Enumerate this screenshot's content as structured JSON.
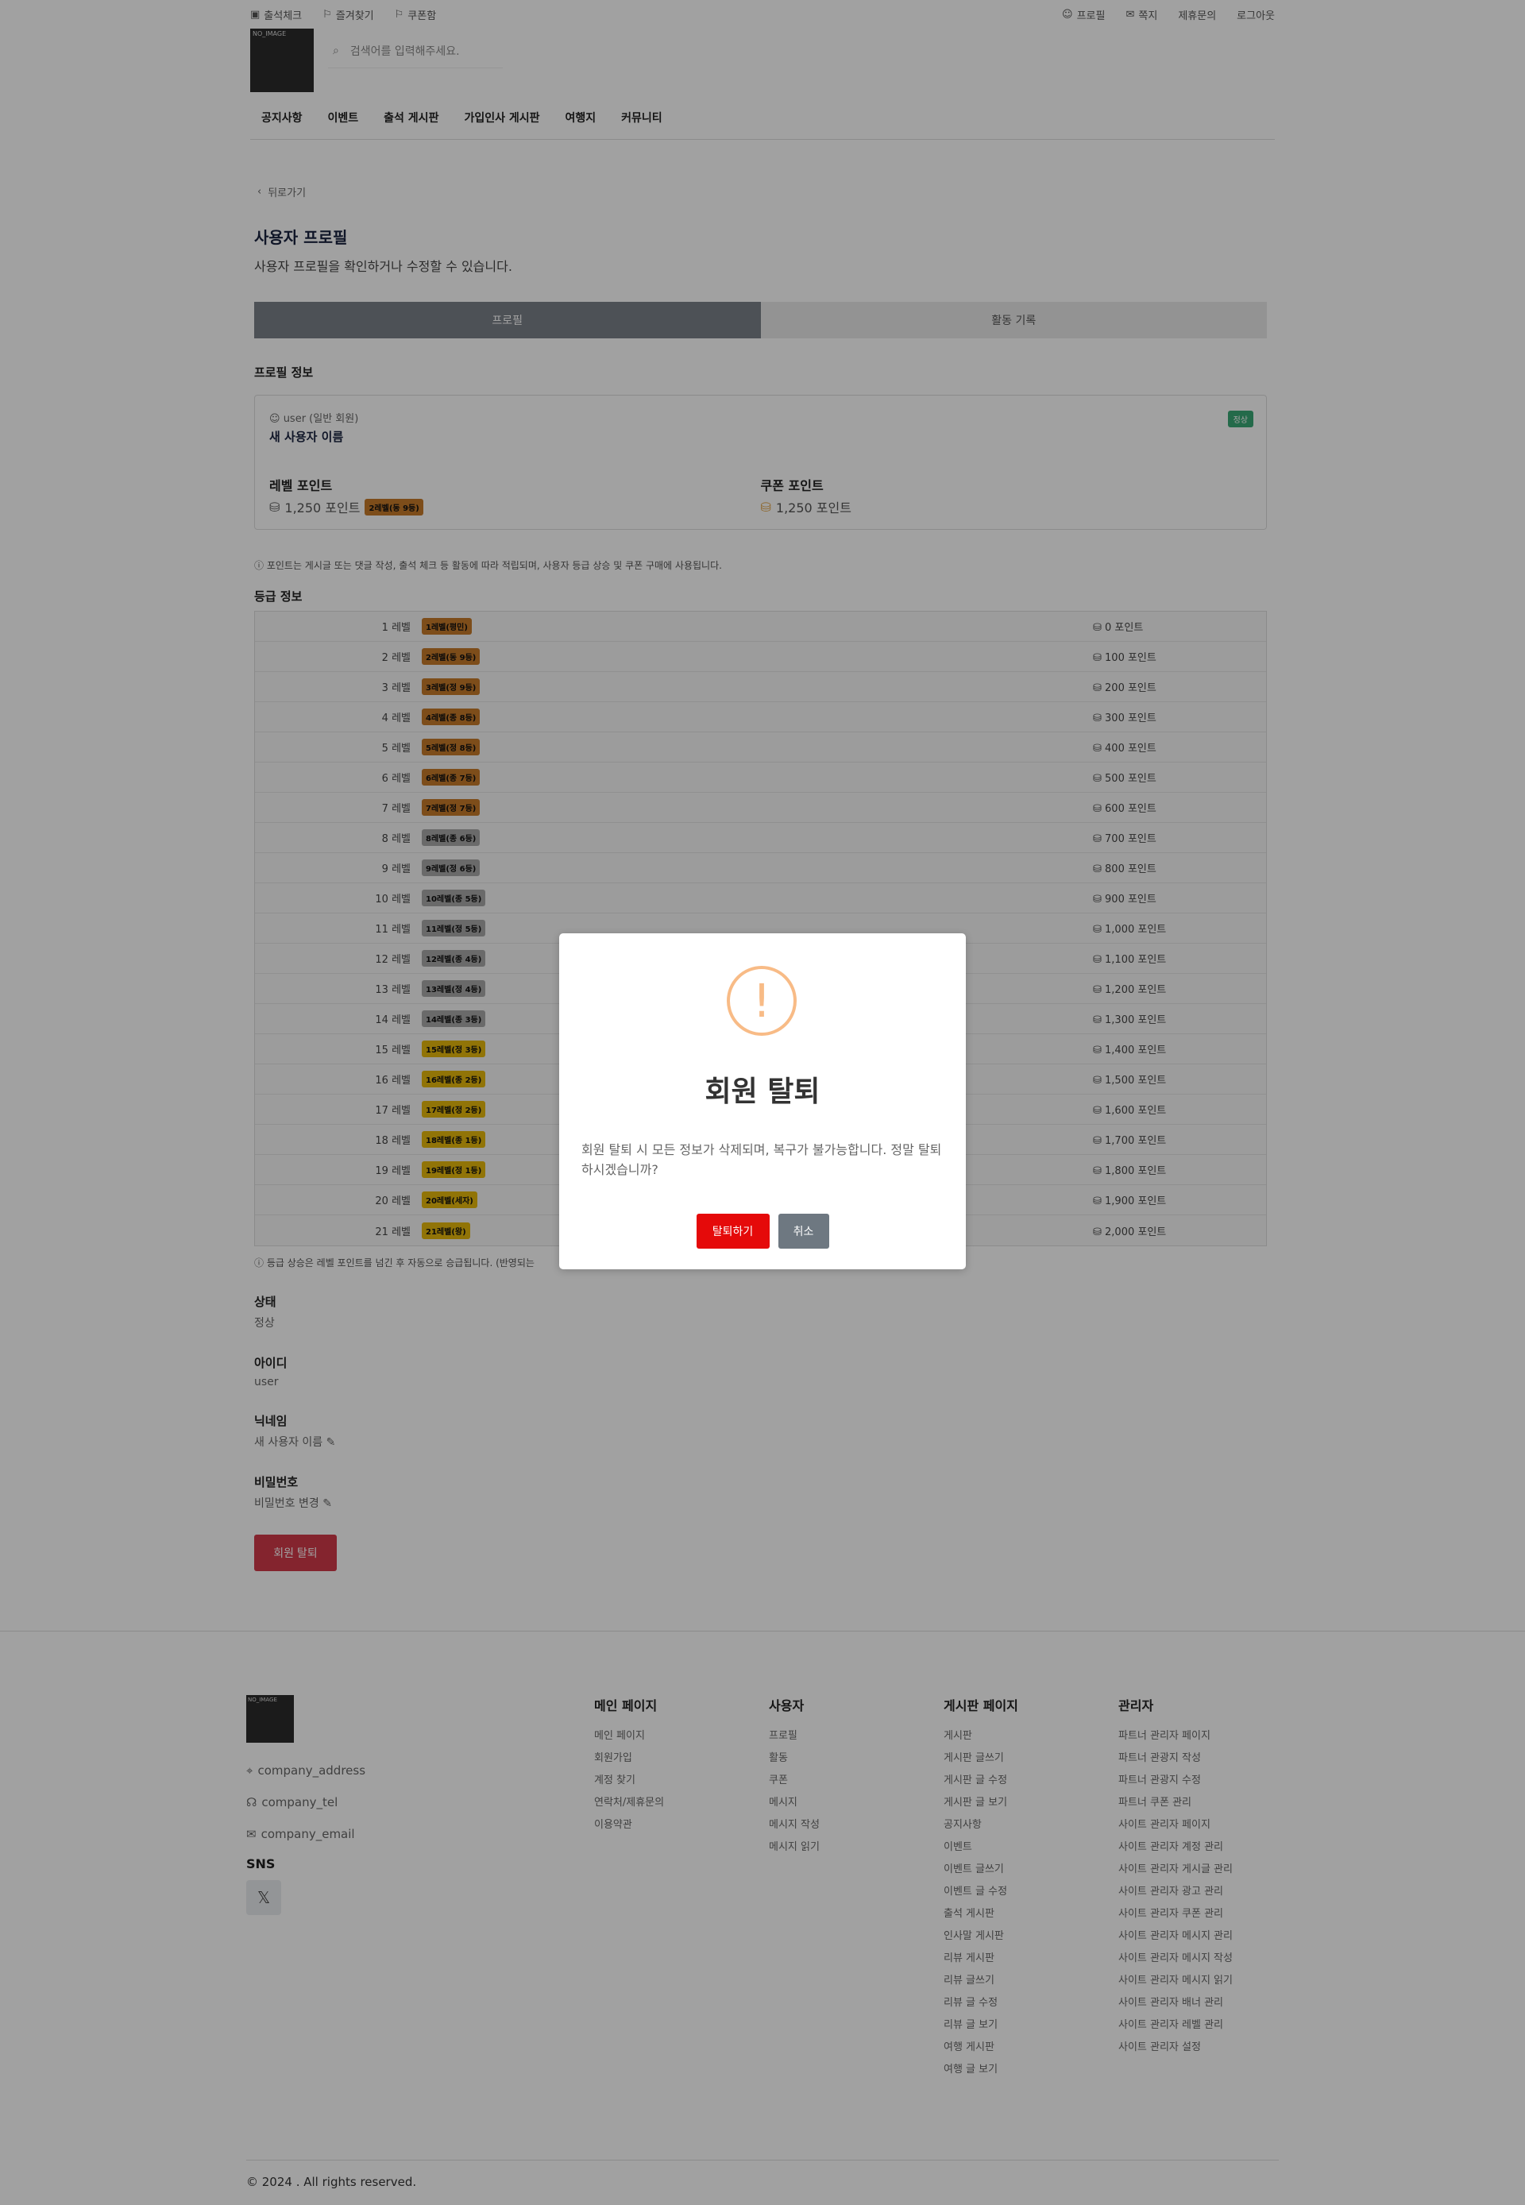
{
  "header": {
    "links_left": [
      "출석체크",
      "즐겨찾기",
      "쿠폰함"
    ],
    "links_right": [
      "프로필",
      "쪽지",
      "제휴문의",
      "로그아웃"
    ],
    "logo_text": "NO_IMAGE",
    "search_placeholder": "검색어를 입력해주세요.",
    "nav": [
      "공지사항",
      "이벤트",
      "출석 게시판",
      "가입인사 게시판",
      "여행지",
      "커뮤니티"
    ]
  },
  "page": {
    "back": "뒤로가기",
    "title": "사용자 프로필",
    "subtitle": "사용자 프로필을 확인하거나 수정할 수 있습니다.",
    "tabs": [
      "프로필",
      "활동 기록"
    ],
    "profile_section": "프로필 정보",
    "role": "user (일반 회원)",
    "user_name": "새 사용자 이름",
    "status_badge": "정상",
    "level_point_label": "레벨 포인트",
    "level_point_value": "1,250 포인트",
    "level_badge": "2레벨(동 9등)",
    "coupon_point_label": "쿠폰 포인트",
    "coupon_point_value": "1,250 포인트",
    "points_note": "포인트는 게시글 또는 댓글 작성, 출석 체크 등 활동에 따라 적립되며, 사용자 등급 상승 및 쿠폰 구매에 사용됩니다.",
    "grade_section": "등급 정보",
    "grade_note": "등급 상승은 레벨 포인트를 넘긴 후 자동으로 승급됩니다. (반영되는",
    "status_label": "상태",
    "status_value": "정상",
    "id_label": "아이디",
    "id_value": "user",
    "nick_label": "닉네임",
    "nick_value": "새 사용자 이름",
    "pw_label": "비밀번호",
    "pw_value": "비밀번호 변경",
    "withdraw_button": "회원 탈퇴"
  },
  "levels": [
    {
      "name": "1 레벨",
      "badge": "1레벨(평민)",
      "color": "#c77a2a",
      "points": "0 포인트"
    },
    {
      "name": "2 레벨",
      "badge": "2레벨(동 9등)",
      "color": "#c77a2a",
      "points": "100 포인트"
    },
    {
      "name": "3 레벨",
      "badge": "3레벨(정 9등)",
      "color": "#c77a2a",
      "points": "200 포인트"
    },
    {
      "name": "4 레벨",
      "badge": "4레벨(종 8등)",
      "color": "#c77a2a",
      "points": "300 포인트"
    },
    {
      "name": "5 레벨",
      "badge": "5레벨(정 8등)",
      "color": "#c77a2a",
      "points": "400 포인트"
    },
    {
      "name": "6 레벨",
      "badge": "6레벨(종 7등)",
      "color": "#c77a2a",
      "points": "500 포인트"
    },
    {
      "name": "7 레벨",
      "badge": "7레벨(정 7등)",
      "color": "#c77a2a",
      "points": "600 포인트"
    },
    {
      "name": "8 레벨",
      "badge": "8레벨(종 6등)",
      "color": "#a9a9a9",
      "points": "700 포인트"
    },
    {
      "name": "9 레벨",
      "badge": "9레벨(정 6등)",
      "color": "#a9a9a9",
      "points": "800 포인트"
    },
    {
      "name": "10 레벨",
      "badge": "10레벨(종 5등)",
      "color": "#a9a9a9",
      "points": "900 포인트"
    },
    {
      "name": "11 레벨",
      "badge": "11레벨(정 5등)",
      "color": "#a9a9a9",
      "points": "1,000 포인트"
    },
    {
      "name": "12 레벨",
      "badge": "12레벨(종 4등)",
      "color": "#a9a9a9",
      "points": "1,100 포인트"
    },
    {
      "name": "13 레벨",
      "badge": "13레벨(정 4등)",
      "color": "#a9a9a9",
      "points": "1,200 포인트"
    },
    {
      "name": "14 레벨",
      "badge": "14레벨(종 3등)",
      "color": "#a9a9a9",
      "points": "1,300 포인트"
    },
    {
      "name": "15 레벨",
      "badge": "15레벨(정 3등)",
      "color": "#e6b80c",
      "points": "1,400 포인트"
    },
    {
      "name": "16 레벨",
      "badge": "16레벨(종 2등)",
      "color": "#e6b80c",
      "points": "1,500 포인트"
    },
    {
      "name": "17 레벨",
      "badge": "17레벨(정 2등)",
      "color": "#e6b80c",
      "points": "1,600 포인트"
    },
    {
      "name": "18 레벨",
      "badge": "18레벨(종 1등)",
      "color": "#e6b80c",
      "points": "1,700 포인트"
    },
    {
      "name": "19 레벨",
      "badge": "19레벨(정 1등)",
      "color": "#e6b80c",
      "points": "1,800 포인트"
    },
    {
      "name": "20 레벨",
      "badge": "20레벨(세자)",
      "color": "#e6b80c",
      "points": "1,900 포인트"
    },
    {
      "name": "21 레벨",
      "badge": "21레벨(왕)",
      "color": "#e6b80c",
      "points": "2,000 포인트"
    }
  ],
  "modal": {
    "icon": "!",
    "title": "회원 탈퇴",
    "text": "회원 탈퇴 시 모든 정보가 삭제되며, 복구가 불가능합니다. 정말 탈퇴하시겠습니까?",
    "confirm": "탈퇴하기",
    "cancel": "취소"
  },
  "footer": {
    "logo_text": "NO_IMAGE",
    "address": "company_address",
    "tel": "company_tel",
    "email": "company_email",
    "sns": "SNS",
    "columns": [
      {
        "title": "메인 페이지",
        "items": [
          "메인 페이지",
          "회원가입",
          "계정 찾기",
          "연락처/제휴문의",
          "이용약관"
        ]
      },
      {
        "title": "사용자",
        "items": [
          "프로필",
          "활동",
          "쿠폰",
          "메시지",
          "메시지 작성",
          "메시지 읽기"
        ]
      },
      {
        "title": "게시판 페이지",
        "items": [
          "게시판",
          "게시판 글쓰기",
          "게시판 글 수정",
          "게시판 글 보기",
          "공지사항",
          "이벤트",
          "이벤트 글쓰기",
          "이벤트 글 수정",
          "출석 게시판",
          "인사말 게시판",
          "리뷰 게시판",
          "리뷰 글쓰기",
          "리뷰 글 수정",
          "리뷰 글 보기",
          "여행 게시판",
          "여행 글 보기"
        ]
      },
      {
        "title": "관리자",
        "items": [
          "파트너 관리자 페이지",
          "파트너 관광지 작성",
          "파트너 관광지 수정",
          "파트너 쿠폰 관리",
          "사이트 관리자 페이지",
          "사이트 관리자 계정 관리",
          "사이트 관리자 게시글 관리",
          "사이트 관리자 광고 관리",
          "사이트 관리자 쿠폰 관리",
          "사이트 관리자 메시지 관리",
          "사이트 관리자 메시지 작성",
          "사이트 관리자 메시지 읽기",
          "사이트 관리자 배너 관리",
          "사이트 관리자 레벨 관리",
          "사이트 관리자 설정"
        ]
      }
    ],
    "copyright": "© 2024 . All rights reserved."
  }
}
